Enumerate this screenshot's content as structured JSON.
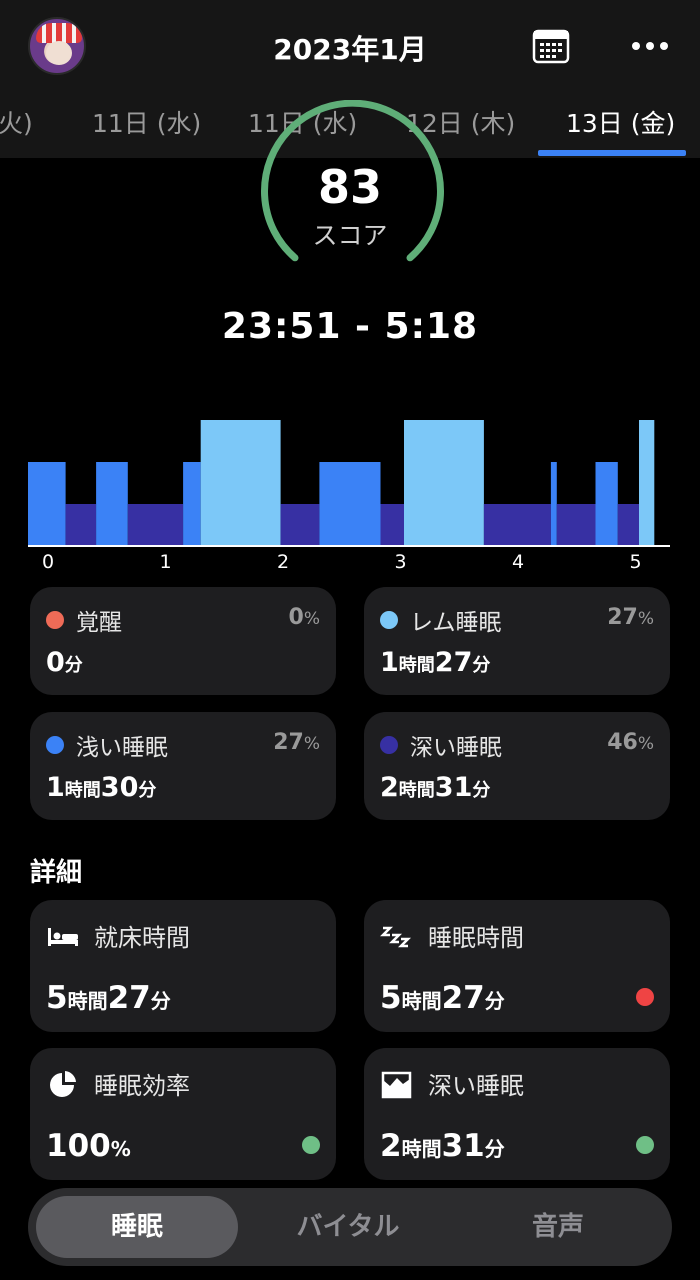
{
  "header": {
    "title": "2023年1月"
  },
  "tabs": [
    "火)",
    "11日 (水)",
    "11日 (水)",
    "12日 (木)",
    "13日 (金)"
  ],
  "score": {
    "value": "83",
    "label": "スコア",
    "fraction": 0.83
  },
  "sleep_range": "23:51 - 5:18",
  "chart_data": {
    "type": "hypnogram",
    "x_ticks": [
      "0",
      "1",
      "2",
      "3",
      "4",
      "5"
    ],
    "stages": [
      {
        "stage": "light",
        "start": 0.0,
        "end": 0.32
      },
      {
        "stage": "deep",
        "start": 0.32,
        "end": 0.58
      },
      {
        "stage": "light",
        "start": 0.58,
        "end": 0.85
      },
      {
        "stage": "deep",
        "start": 0.85,
        "end": 1.32
      },
      {
        "stage": "light",
        "start": 1.32,
        "end": 1.47
      },
      {
        "stage": "rem",
        "start": 1.47,
        "end": 2.15
      },
      {
        "stage": "deep",
        "start": 2.15,
        "end": 2.48
      },
      {
        "stage": "light",
        "start": 2.48,
        "end": 3.0
      },
      {
        "stage": "deep",
        "start": 3.0,
        "end": 3.2
      },
      {
        "stage": "rem",
        "start": 3.2,
        "end": 3.88
      },
      {
        "stage": "deep",
        "start": 3.88,
        "end": 4.45
      },
      {
        "stage": "light",
        "start": 4.45,
        "end": 4.5
      },
      {
        "stage": "deep",
        "start": 4.5,
        "end": 4.83
      },
      {
        "stage": "light",
        "start": 4.83,
        "end": 5.02
      },
      {
        "stage": "deep",
        "start": 5.02,
        "end": 5.2
      },
      {
        "stage": "rem",
        "start": 5.2,
        "end": 5.33
      }
    ]
  },
  "stages": [
    {
      "name": "覚醒",
      "pct": "0",
      "dur_parts": [
        "0",
        "分"
      ],
      "color": "#ef6b57"
    },
    {
      "name": "レム睡眠",
      "pct": "27",
      "dur_parts": [
        "1",
        "時間",
        "27",
        "分"
      ],
      "color": "#7cc8f8"
    },
    {
      "name": "浅い睡眠",
      "pct": "27",
      "dur_parts": [
        "1",
        "時間",
        "30",
        "分"
      ],
      "color": "#3b82f6"
    },
    {
      "name": "深い睡眠",
      "pct": "46",
      "dur_parts": [
        "2",
        "時間",
        "31",
        "分"
      ],
      "color": "#3730a3"
    }
  ],
  "pct_unit": "%",
  "details_title": "詳細",
  "details": [
    {
      "name": "就床時間",
      "icon": "bed-icon",
      "val_parts": [
        "5",
        "時間",
        "27",
        "分"
      ]
    },
    {
      "name": "睡眠時間",
      "icon": "zzz-icon",
      "val_parts": [
        "5",
        "時間",
        "27",
        "分"
      ],
      "status": "#ef4444"
    },
    {
      "name": "睡眠効率",
      "icon": "pie-icon",
      "val_parts": [
        "100",
        "%"
      ],
      "status": "#6fbf86"
    },
    {
      "name": "深い睡眠",
      "icon": "deep-sleep-icon",
      "val_parts": [
        "2",
        "時間",
        "31",
        "分"
      ],
      "status": "#6fbf86"
    }
  ],
  "bottom_nav": [
    "睡眠",
    "バイタル",
    "音声"
  ]
}
